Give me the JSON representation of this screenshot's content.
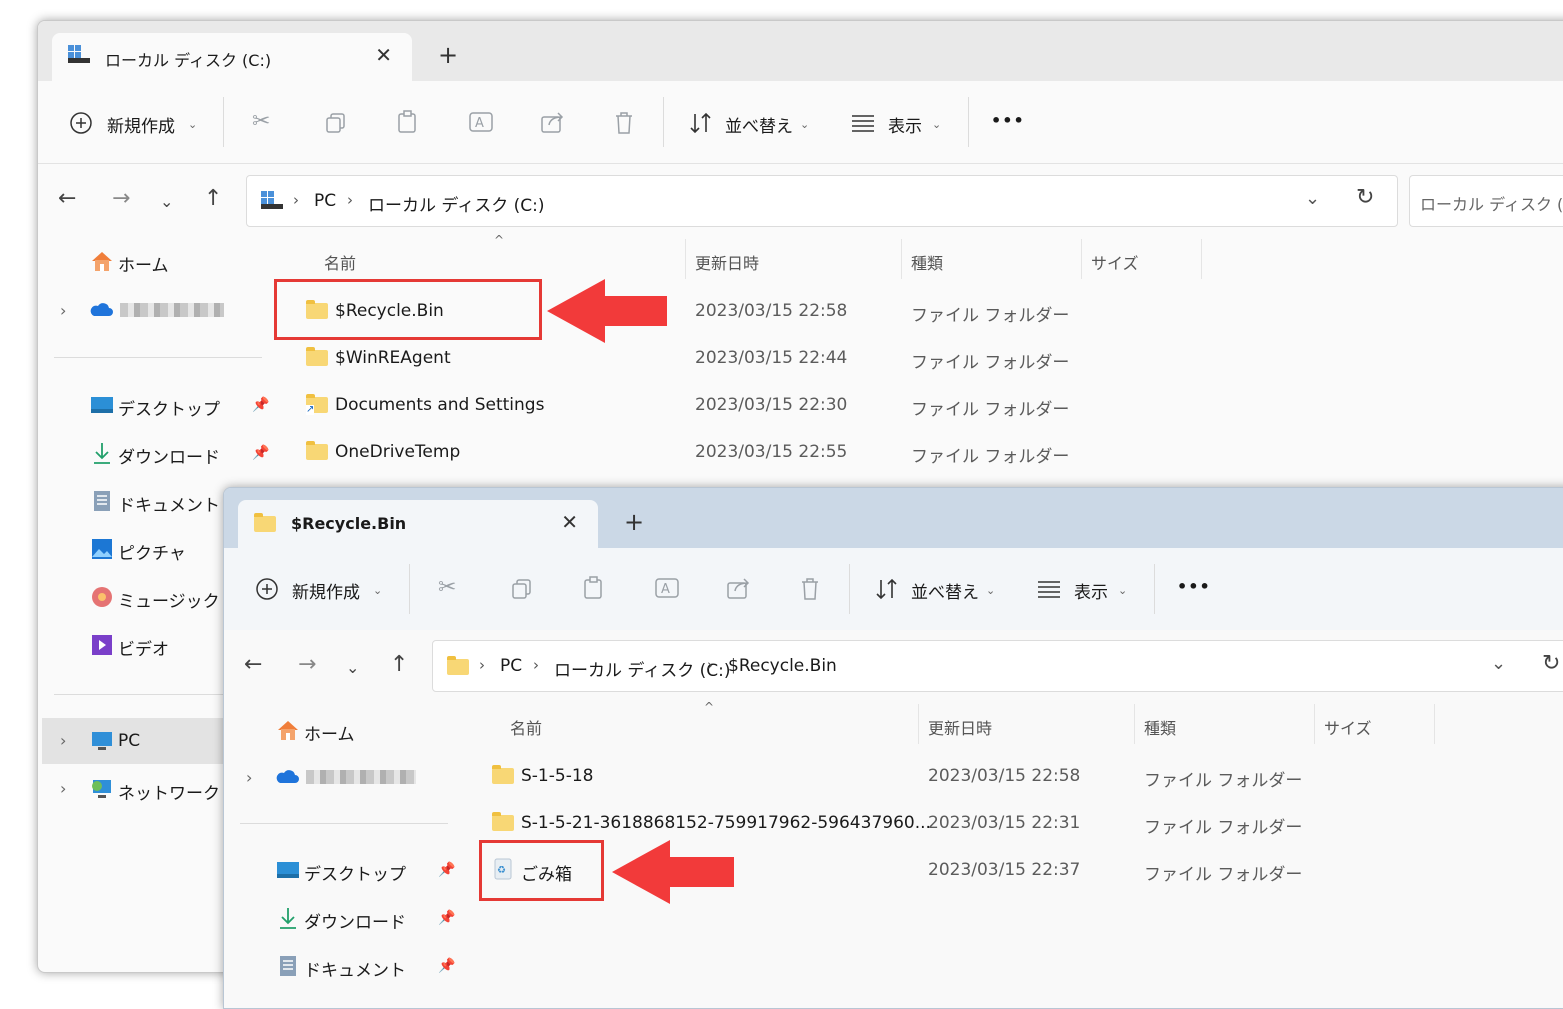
{
  "window1": {
    "tab_title": "ローカル ディスク (C:)",
    "tab_close": "✕",
    "new_tab": "+",
    "toolbar": {
      "new_label": "新規作成",
      "sort_label": "並べ替え",
      "view_label": "表示",
      "more_label": "•••"
    },
    "breadcrumb": [
      "PC",
      "ローカル ディスク (C:)"
    ],
    "search_placeholder": "ローカル ディスク (C:)",
    "sidebar": {
      "home": "ホーム",
      "items": [
        "デスクトップ",
        "ダウンロード",
        "ドキュメント",
        "ピクチャ",
        "ミュージック",
        "ビデオ"
      ],
      "pc": "PC",
      "network": "ネットワーク"
    },
    "columns": {
      "name": "名前",
      "date": "更新日時",
      "type": "種類",
      "size": "サイズ"
    },
    "rows": [
      {
        "name": "$Recycle.Bin",
        "date": "2023/03/15 22:58",
        "type": "ファイル フォルダー"
      },
      {
        "name": "$WinREAgent",
        "date": "2023/03/15 22:44",
        "type": "ファイル フォルダー"
      },
      {
        "name": "Documents and Settings",
        "date": "2023/03/15 22:30",
        "type": "ファイル フォルダー"
      },
      {
        "name": "OneDriveTemp",
        "date": "2023/03/15 22:55",
        "type": "ファイル フォルダー"
      }
    ]
  },
  "window2": {
    "tab_title": "$Recycle.Bin",
    "tab_close": "✕",
    "new_tab": "+",
    "toolbar": {
      "new_label": "新規作成",
      "sort_label": "並べ替え",
      "view_label": "表示",
      "more_label": "•••"
    },
    "breadcrumb": [
      "PC",
      "ローカル ディスク (C:)",
      "$Recycle.Bin"
    ],
    "sidebar": {
      "home": "ホーム",
      "items": [
        "デスクトップ",
        "ダウンロード",
        "ドキュメント"
      ]
    },
    "columns": {
      "name": "名前",
      "date": "更新日時",
      "type": "種類",
      "size": "サイズ"
    },
    "rows": [
      {
        "name": "S-1-5-18",
        "date": "2023/03/15 22:58",
        "type": "ファイル フォルダー"
      },
      {
        "name": "S-1-5-21-3618868152-759917962-596437960...",
        "date": "2023/03/15 22:31",
        "type": "ファイル フォルダー"
      },
      {
        "name": "ごみ箱",
        "date": "2023/03/15 22:37",
        "type": "ファイル フォルダー"
      }
    ]
  },
  "colors": {
    "highlight": "#e53935",
    "arrow": "#f23a3a",
    "folder": "#f8d775"
  }
}
